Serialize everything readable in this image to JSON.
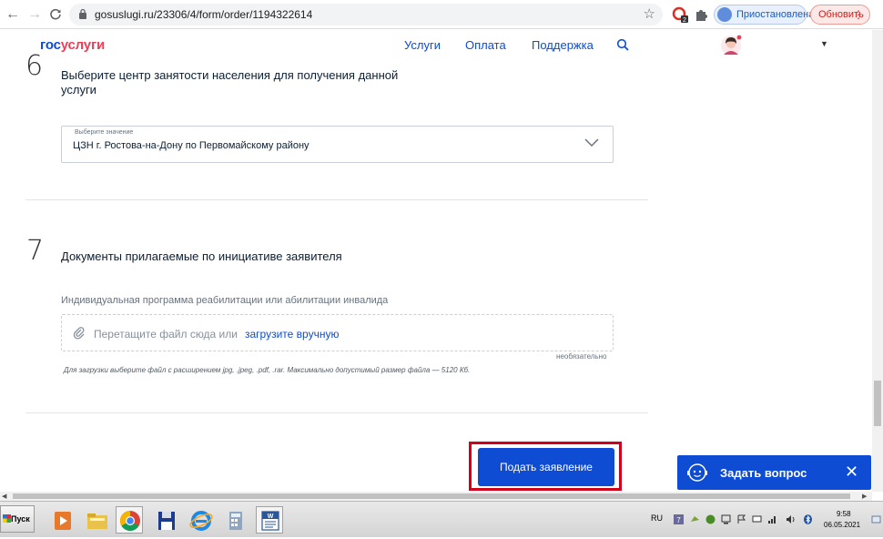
{
  "browser": {
    "url": "gosuslugi.ru/23306/4/form/order/1194322614",
    "profile_label": "Приостановлена",
    "update_label": "Обновить"
  },
  "site": {
    "logo_part1": "гос",
    "logo_part2": "услуги",
    "nav": [
      "Услуги",
      "Оплата",
      "Поддержка"
    ]
  },
  "form": {
    "step6": {
      "number": "6",
      "title_line1": "Выберите центр занятости населения для получения данной",
      "title_line2": "услуги",
      "select_caption": "Выберите значение",
      "select_value": "ЦЗН г. Ростова-на-Дону по Первомайскому району"
    },
    "step7": {
      "number": "7",
      "title": "Документы прилагаемые по инициативе заявителя",
      "doc_label": "Индивидуальная программа реабилитации или абилитации инвалида",
      "drop_text": "Перетащите файл сюда или",
      "upload_link": "загрузите вручную",
      "optional": "необязательно",
      "hint": "Для загрузки выберите файл с расширением jpg, .jpeg, .pdf, .rar. Максимально допустимый размер файла — 5120 Кб."
    },
    "submit_label": "Подать заявление"
  },
  "chat": {
    "label": "Задать вопрос"
  },
  "taskbar": {
    "start_label": "Пуск",
    "lang": "RU",
    "time": "9:58",
    "date": "06.05.2021"
  },
  "colors": {
    "brand_blue": "#0d4cd3",
    "brand_red": "#ee3f58",
    "highlight_red": "#d0021b"
  }
}
